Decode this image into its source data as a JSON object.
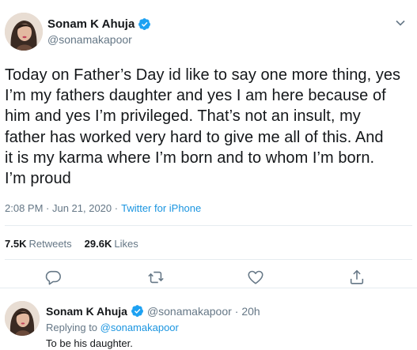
{
  "tweet": {
    "author_name": "Sonam K Ahuja",
    "author_handle": "@sonamakapoor",
    "text": "Today on Father’s Day id like to say one more thing, yes\nI’m my fathers daughter and yes I am here because of\nhim and yes I’m privileged. That’s not an insult, my\nfather has worked very hard to give me all of this. And\nit is my karma where I’m born and to whom I’m born.\nI’m proud",
    "time": "2:08 PM · Jun 21, 2020 ·",
    "source": "Twitter for iPhone",
    "retweets_count": "7.5K",
    "retweets_label": "Retweets",
    "likes_count": "29.6K",
    "likes_label": "Likes"
  },
  "reply": {
    "author_name": "Sonam K Ahuja",
    "author_handle": "@sonamakapoor",
    "time": "· 20h",
    "replying_prefix": "Replying to",
    "replying_handle": "@sonamakapoor",
    "text": "To be his daughter."
  },
  "icons": {
    "verified": "verified-badge-icon",
    "caret": "chevron-down-icon",
    "reply": "reply-bubble-icon",
    "retweet": "retweet-icon",
    "like": "heart-icon",
    "share": "share-icon"
  },
  "colors": {
    "accent": "#1b95e0",
    "text": "#14171a",
    "muted": "#657786",
    "verified": "#1da1f2",
    "border": "#e6ecf0"
  }
}
